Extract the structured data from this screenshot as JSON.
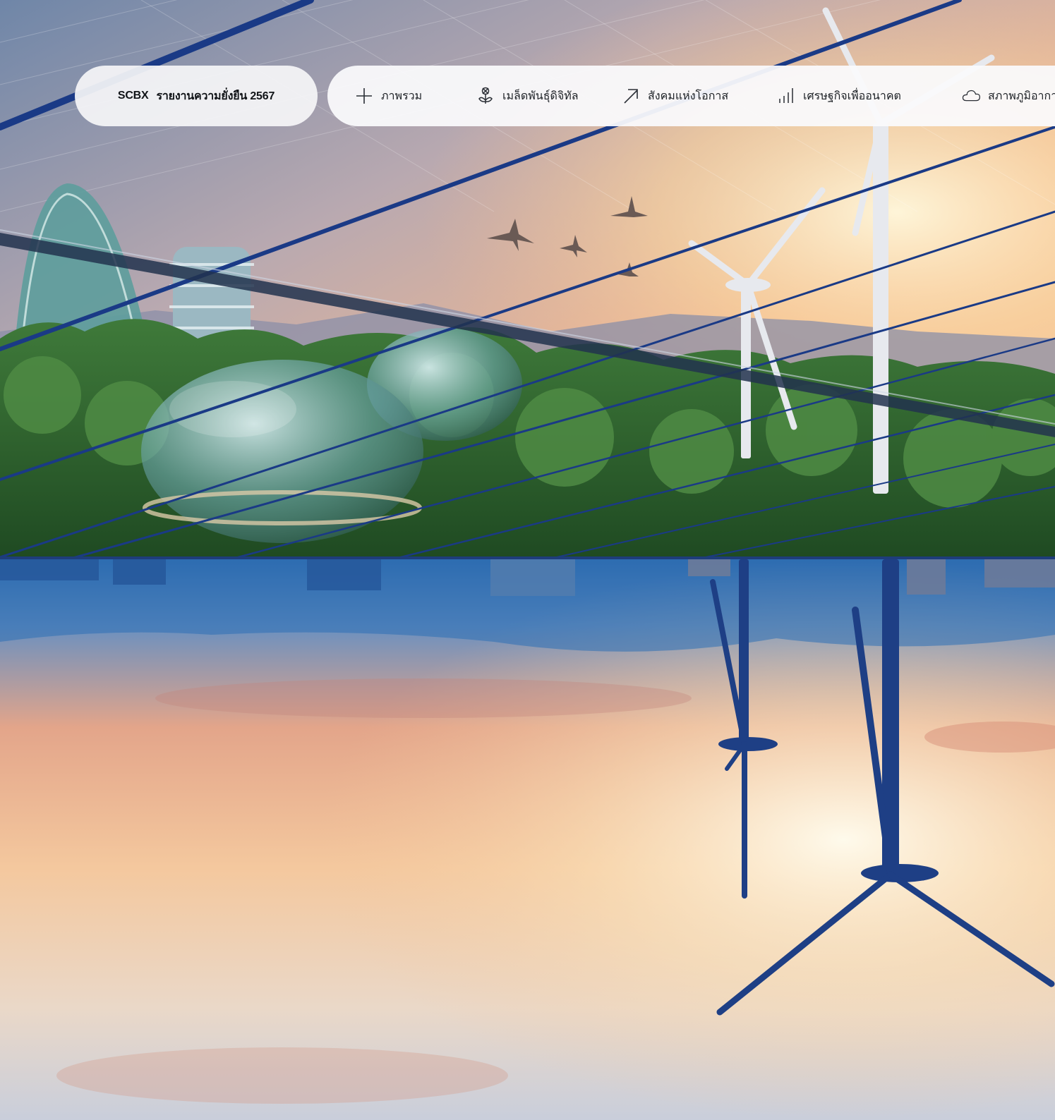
{
  "brand": {
    "logo_text": "SCBX",
    "report_title": "รายงานความยั่งยืน 2567"
  },
  "nav": {
    "items": [
      {
        "label": "ภาพรวม",
        "icon": "plus-icon"
      },
      {
        "label": "เมล็ดพันธุ์ดิจิทัล",
        "icon": "seedling-icon"
      },
      {
        "label": "สังคมแห่งโอกาส",
        "icon": "arrow-up-right-icon"
      },
      {
        "label": "เศรษฐกิจเพื่ออนาคต",
        "icon": "bar-chart-icon"
      },
      {
        "label": "สภาพภูมิอากาศ",
        "icon": "cloud-icon"
      }
    ],
    "active_index": 3
  },
  "colors": {
    "accent_blue": "#1b3f8f",
    "pill_bg": "#f5f5f7"
  }
}
